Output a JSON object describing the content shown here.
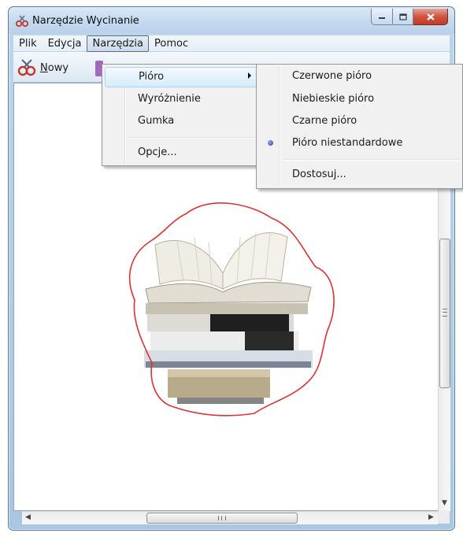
{
  "window": {
    "title": "Narzędzie Wycinanie",
    "accent": "#b9d1ea"
  },
  "menubar": {
    "items": [
      {
        "label": "Plik"
      },
      {
        "label": "Edycja"
      },
      {
        "label": "Narzędzia",
        "active": true
      },
      {
        "label": "Pomoc"
      }
    ]
  },
  "toolbar": {
    "new_label": "Nowy",
    "new_mnemonic": "N",
    "new_rest": "owy",
    "new_icon": "scissors-icon",
    "save_icon": "save-icon"
  },
  "tools_menu": {
    "items": [
      {
        "label": "Pióro",
        "has_submenu": true,
        "highlighted": true
      },
      {
        "label": "Wyróżnienie"
      },
      {
        "label": "Gumka"
      },
      {
        "label": "Opcje..."
      }
    ]
  },
  "pen_submenu": {
    "items": [
      {
        "label": "Czerwone pióro"
      },
      {
        "label": "Niebieskie pióro"
      },
      {
        "label": "Czarne pióro"
      },
      {
        "label": "Pióro niestandardowe",
        "checked": true
      },
      {
        "label": "Dostosuj..."
      }
    ]
  },
  "scrollbar": {
    "h_grip": "III",
    "v_grip": "≡"
  },
  "colors": {
    "ink_outline": "#e03030",
    "radio_selected": "#3b49b8"
  }
}
